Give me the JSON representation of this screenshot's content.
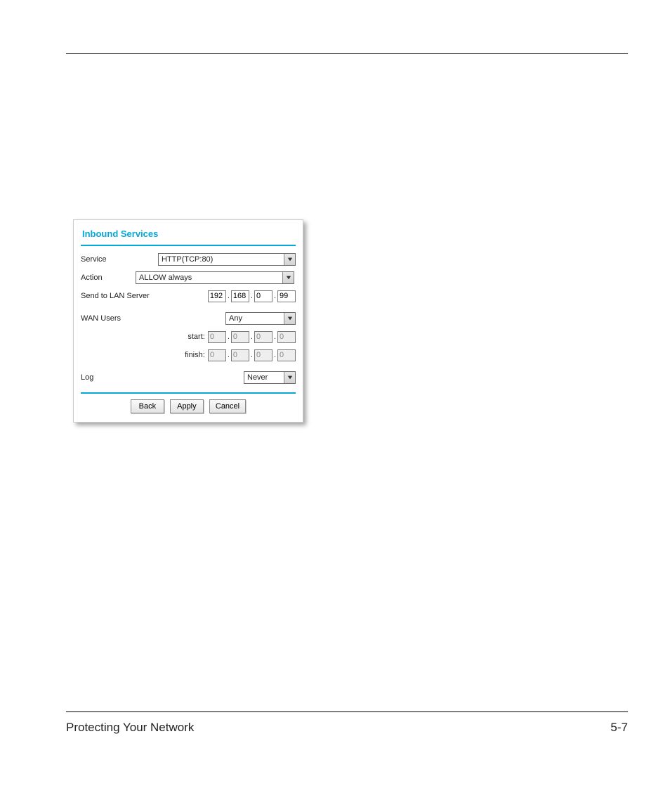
{
  "footer": {
    "left": "Protecting Your Network",
    "page": "5-7"
  },
  "dialog": {
    "title": "Inbound Services",
    "labels": {
      "service": "Service",
      "action": "Action",
      "send_to": "Send to LAN Server",
      "wan_users": "WAN Users",
      "start": "start:",
      "finish": "finish:",
      "log": "Log"
    },
    "service_select": "HTTP(TCP:80)",
    "action_select": "ALLOW always",
    "lan_ip": {
      "o1": "192",
      "o2": "168",
      "o3": "0",
      "o4": "99"
    },
    "wan_users_select": "Any",
    "start_ip": {
      "o1": "0",
      "o2": "0",
      "o3": "0",
      "o4": "0"
    },
    "finish_ip": {
      "o1": "0",
      "o2": "0",
      "o3": "0",
      "o4": "0"
    },
    "log_select": "Never",
    "buttons": {
      "back": "Back",
      "apply": "Apply",
      "cancel": "Cancel"
    }
  }
}
